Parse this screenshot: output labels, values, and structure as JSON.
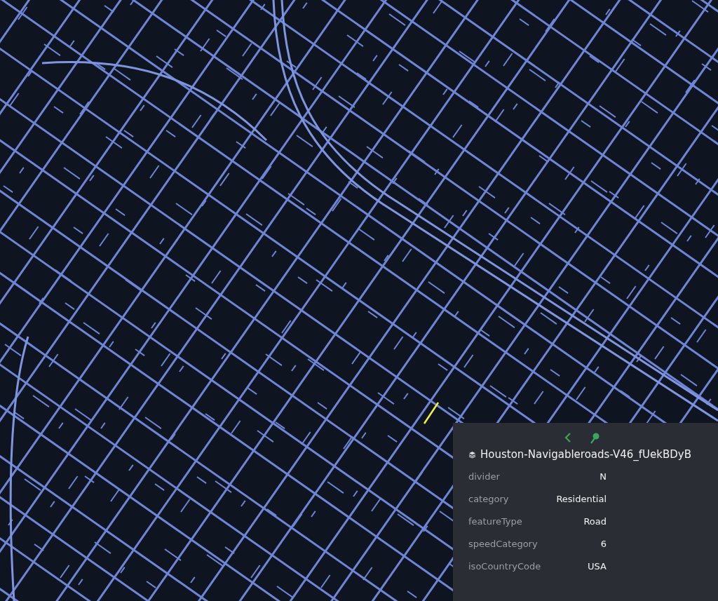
{
  "feature_popup": {
    "title": "Houston-Navigableroads-V46_fUekBDyB",
    "properties": [
      {
        "name": "divider",
        "value": "N"
      },
      {
        "name": "category",
        "value": "Residential"
      },
      {
        "name": "featureType",
        "value": "Road"
      },
      {
        "name": "speedCategory",
        "value": "6"
      },
      {
        "name": "isoCountryCode",
        "value": "USA"
      }
    ]
  }
}
